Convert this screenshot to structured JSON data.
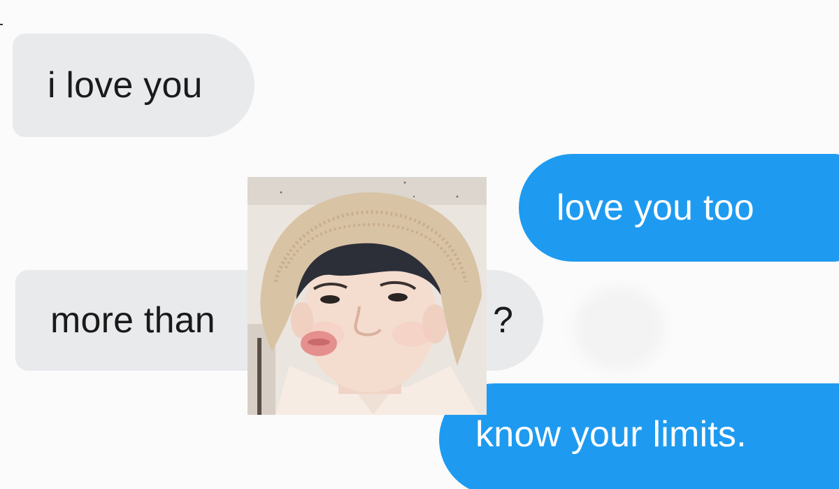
{
  "messages": [
    {
      "id": "m1",
      "direction": "incoming",
      "text": "i love you"
    },
    {
      "id": "m2",
      "direction": "outgoing",
      "text": "love you too"
    },
    {
      "id": "m3",
      "direction": "incoming",
      "text": "more than",
      "suffix": "?"
    },
    {
      "id": "m4",
      "direction": "outgoing",
      "text": "know your limits."
    }
  ],
  "overlay_photo": {
    "subject": "person-in-bucket-hat",
    "icon": "person-face-photo"
  },
  "colors": {
    "background": "#fbfbfb",
    "incoming_bubble": "#e9eaec",
    "outgoing_bubble": "#1e9bf0",
    "incoming_text": "#1a1a1a",
    "outgoing_text": "#ffffff"
  }
}
